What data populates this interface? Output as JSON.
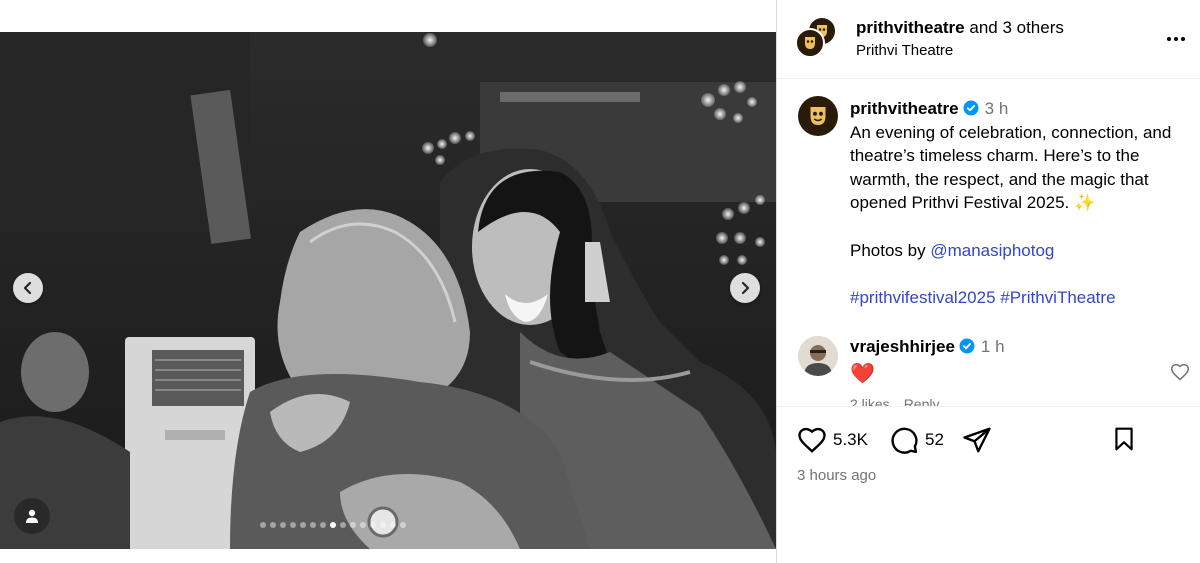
{
  "media": {
    "prev_icon": "chevron-left-icon",
    "next_icon": "chevron-right-icon",
    "tag_icon": "user-icon",
    "carousel": {
      "count": 15,
      "active": 7
    }
  },
  "header": {
    "username": "prithvitheatre",
    "collab_suffix": " and 3 others",
    "location": "Prithvi Theatre",
    "more_icon": "more-dots-icon"
  },
  "caption": {
    "username": "prithvitheatre",
    "time": "3 h",
    "text": "An evening of celebration, connection, and theatre’s timeless charm. Here’s to the warmth, the respect, and the magic that opened Prithvi Festival 2025. ✨",
    "credit_prefix": "Photos by ",
    "credit_handle": "@manasiphotog",
    "hashtags": "#prithvifestival2025 #PrithviTheatre"
  },
  "comment": {
    "username": "vrajeshhirjee",
    "time": "1 h",
    "text": "❤️",
    "likes": "2 likes",
    "reply": "Reply"
  },
  "actions": {
    "likes_count": "5.3K",
    "comments_count": "52",
    "posted": "3 hours ago"
  },
  "colors": {
    "link": "#3446c9",
    "verified": "#0095f6",
    "heart": "#e0245e",
    "muted": "#737373"
  }
}
